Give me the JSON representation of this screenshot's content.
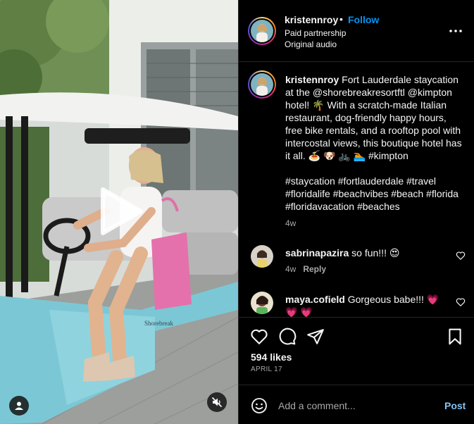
{
  "post": {
    "author": "kristennroy",
    "separator": "•",
    "follow_label": "Follow",
    "subtitle_1": "Paid partnership",
    "subtitle_2": "Original audio"
  },
  "caption": {
    "username": "kristennroy",
    "text_1": " Fort Lauderdale staycation at the @shorebreakresortftl @kimpton hotel! 🌴 With a scratch-made Italian restaurant, dog-friendly happy hours, free bike rentals, and a rooftop pool with intercostal views, this boutique hotel has it all. 🍝 🐶 🚲 🏊 #kimpton",
    "hashtags": "#staycation #fortlauderdale #travel #floridalife #beachvibes #beach #florida #floridavacation #beaches",
    "time": "4w"
  },
  "comments": [
    {
      "username": "sabrinapazira",
      "text": " so fun!!! 😍",
      "time": "4w",
      "reply_label": "Reply"
    },
    {
      "username": "maya.cofield",
      "text": " Gorgeous babe!!! 💗 💗 💗"
    }
  ],
  "engagement": {
    "likes": "594 likes",
    "date": "APRIL 17"
  },
  "composer": {
    "placeholder": "Add a comment...",
    "post_label": "Post"
  },
  "media": {
    "cart_brand": "Shorebreak"
  },
  "colors": {
    "accent": "#0095f6",
    "post_disabled": "#85c2f0",
    "secondary_text": "#a8a8a8",
    "divider": "#262626"
  },
  "icons": [
    "play-icon",
    "user-tag-icon",
    "muted-speaker-icon",
    "more-options-icon",
    "heart-icon",
    "comment-icon",
    "share-icon",
    "bookmark-icon",
    "emoji-icon"
  ]
}
